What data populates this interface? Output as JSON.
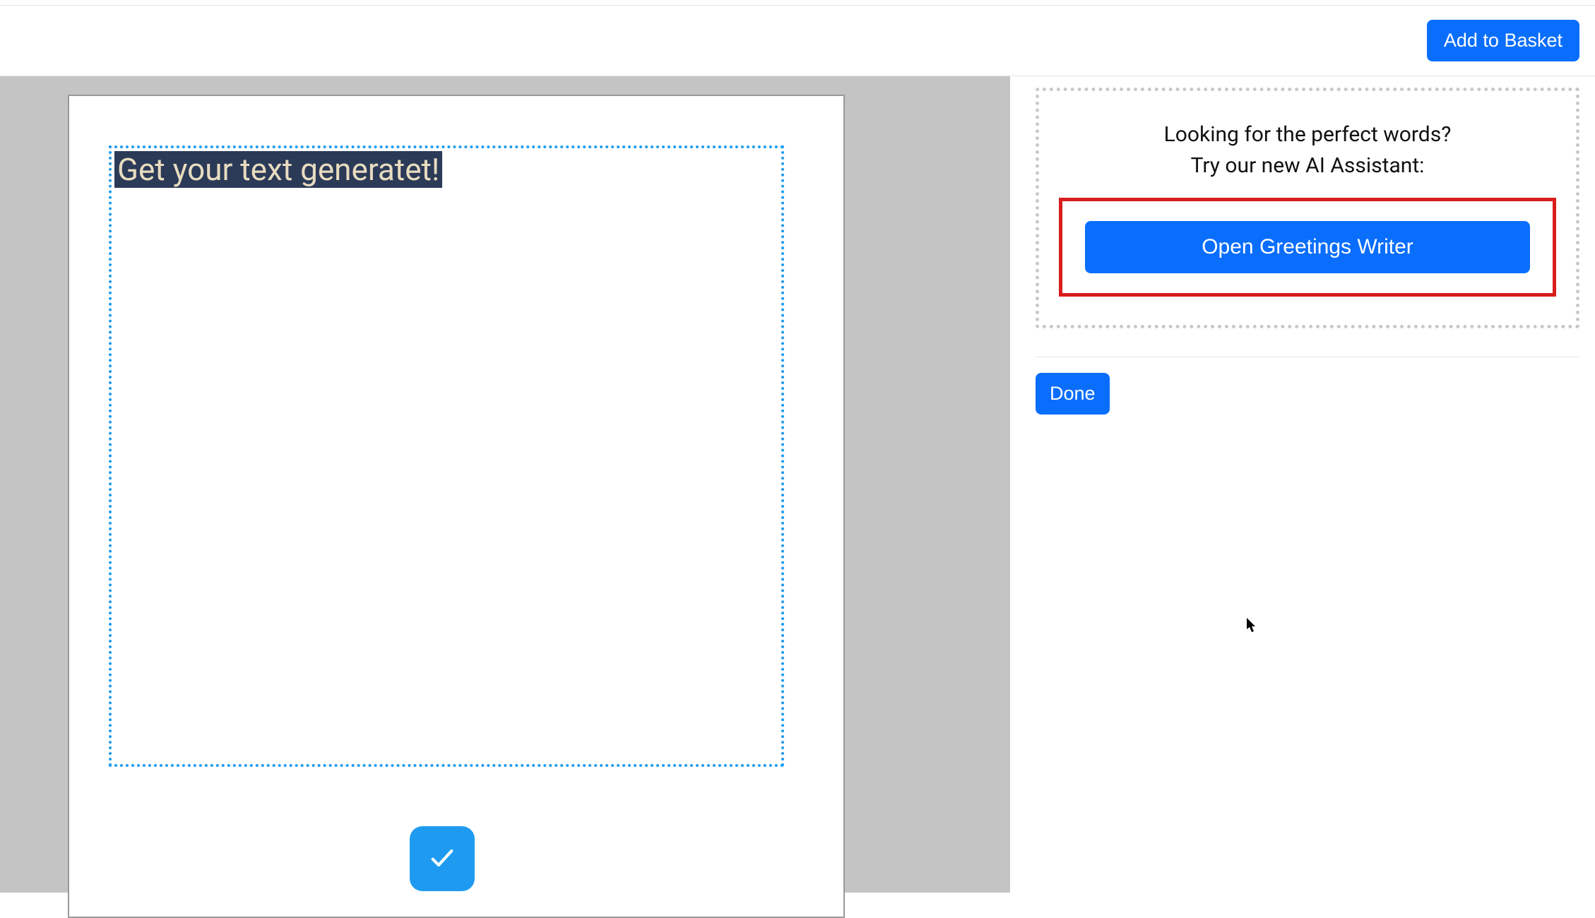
{
  "header": {
    "add_to_basket_label": "Add to Basket"
  },
  "canvas": {
    "text_content": "Get your text generatet!"
  },
  "side_panel": {
    "ai_prompt_line1": "Looking for the perfect words?",
    "ai_prompt_line2": "Try our new AI Assistant:",
    "open_greetings_writer_label": "Open Greetings Writer",
    "done_label": "Done"
  },
  "icons": {
    "checkmark": "checkmark-icon"
  },
  "colors": {
    "primary_blue": "#0a6efd",
    "accent_blue": "#1e9bf0",
    "highlight_red": "#d91d1d",
    "dark_navy": "#2b3a57",
    "cream_text": "#e8dcc0",
    "canvas_bg": "#c4c4c4"
  }
}
